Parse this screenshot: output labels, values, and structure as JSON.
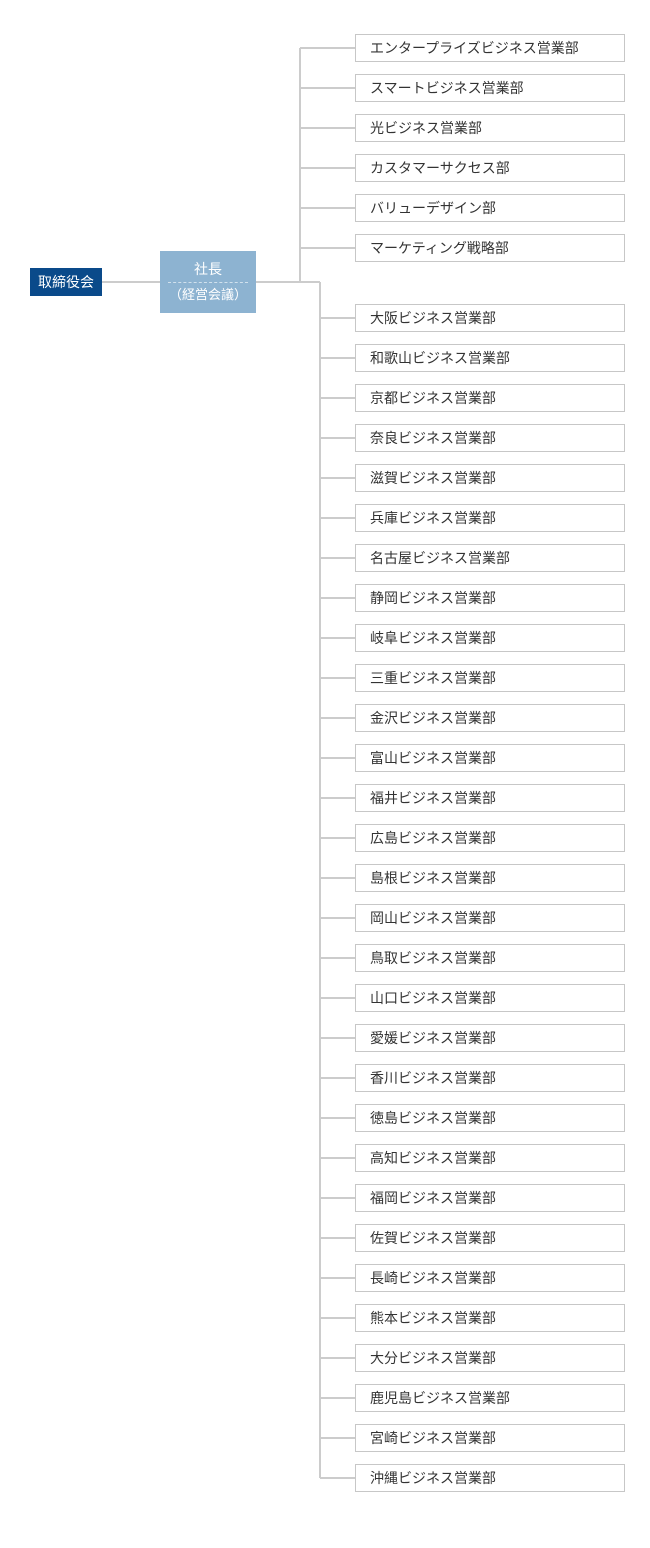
{
  "root": {
    "label": "取締役会"
  },
  "president": {
    "label": "社長",
    "sub": "（経営会議）"
  },
  "group1": [
    "エンタープライズビジネス営業部",
    "スマートビジネス営業部",
    "光ビジネス営業部",
    "カスタマーサクセス部",
    "バリューデザイン部",
    "マーケティング戦略部"
  ],
  "group2": [
    "大阪ビジネス営業部",
    "和歌山ビジネス営業部",
    "京都ビジネス営業部",
    "奈良ビジネス営業部",
    "滋賀ビジネス営業部",
    "兵庫ビジネス営業部",
    "名古屋ビジネス営業部",
    "静岡ビジネス営業部",
    "岐阜ビジネス営業部",
    "三重ビジネス営業部",
    "金沢ビジネス営業部",
    "富山ビジネス営業部",
    "福井ビジネス営業部",
    "広島ビジネス営業部",
    "島根ビジネス営業部",
    "岡山ビジネス営業部",
    "鳥取ビジネス営業部",
    "山口ビジネス営業部",
    "愛媛ビジネス営業部",
    "香川ビジネス営業部",
    "徳島ビジネス営業部",
    "高知ビジネス営業部",
    "福岡ビジネス営業部",
    "佐賀ビジネス営業部",
    "長崎ビジネス営業部",
    "熊本ビジネス営業部",
    "大分ビジネス営業部",
    "鹿児島ビジネス営業部",
    "宮崎ビジネス営業部",
    "沖縄ビジネス営業部"
  ]
}
